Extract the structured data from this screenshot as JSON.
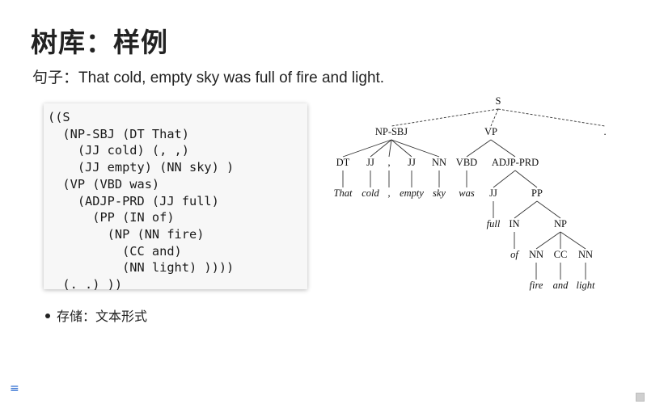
{
  "slide": {
    "title": "树库：样例",
    "sentence_label": "句子：",
    "sentence_text": "That cold, empty sky was full of fire and light.",
    "bullet": "存储：文本形式"
  },
  "code_lines": [
    "((S",
    "  (NP-SBJ (DT That)",
    "    (JJ cold) (, ,)",
    "    (JJ empty) (NN sky) )",
    "  (VP (VBD was)",
    "    (ADJP-PRD (JJ full)",
    "      (PP (IN of)",
    "        (NP (NN fire)",
    "          (CC and)",
    "          (NN light) ))))",
    "  (. .) ))"
  ],
  "tree": {
    "nodes": [
      {
        "id": "S",
        "label": "S",
        "kind": "cat"
      },
      {
        "id": "NPSBJ",
        "label": "NP-SBJ",
        "kind": "cat"
      },
      {
        "id": "VP",
        "label": "VP",
        "kind": "cat"
      },
      {
        "id": "DOT",
        "label": ".",
        "kind": "cat"
      },
      {
        "id": "DT",
        "label": "DT",
        "kind": "cat"
      },
      {
        "id": "JJ1",
        "label": "JJ",
        "kind": "cat"
      },
      {
        "id": "COMMA",
        "label": ",",
        "kind": "cat"
      },
      {
        "id": "JJ2",
        "label": "JJ",
        "kind": "cat"
      },
      {
        "id": "NN1",
        "label": "NN",
        "kind": "cat"
      },
      {
        "id": "VBD",
        "label": "VBD",
        "kind": "cat"
      },
      {
        "id": "ADJP",
        "label": "ADJP-PRD",
        "kind": "cat"
      },
      {
        "id": "JJ3",
        "label": "JJ",
        "kind": "cat"
      },
      {
        "id": "PP",
        "label": "PP",
        "kind": "cat"
      },
      {
        "id": "IN",
        "label": "IN",
        "kind": "cat"
      },
      {
        "id": "NP2",
        "label": "NP",
        "kind": "cat"
      },
      {
        "id": "NN2",
        "label": "NN",
        "kind": "cat"
      },
      {
        "id": "CC",
        "label": "CC",
        "kind": "cat"
      },
      {
        "id": "NN3",
        "label": "NN",
        "kind": "cat"
      },
      {
        "id": "w_that",
        "label": "That",
        "kind": "word"
      },
      {
        "id": "w_cold",
        "label": "cold",
        "kind": "word"
      },
      {
        "id": "w_comma",
        "label": ",",
        "kind": "word"
      },
      {
        "id": "w_empty",
        "label": "empty",
        "kind": "word"
      },
      {
        "id": "w_sky",
        "label": "sky",
        "kind": "word"
      },
      {
        "id": "w_was",
        "label": "was",
        "kind": "word"
      },
      {
        "id": "w_full",
        "label": "full",
        "kind": "word"
      },
      {
        "id": "w_of",
        "label": "of",
        "kind": "word"
      },
      {
        "id": "w_fire",
        "label": "fire",
        "kind": "word"
      },
      {
        "id": "w_and",
        "label": "and",
        "kind": "word"
      },
      {
        "id": "w_light",
        "label": "light",
        "kind": "word"
      }
    ],
    "edges": [
      {
        "from": "S",
        "to": "NPSBJ",
        "style": "dashed"
      },
      {
        "from": "S",
        "to": "VP",
        "style": "dashed"
      },
      {
        "from": "S",
        "to": "DOT",
        "style": "dashed"
      },
      {
        "from": "NPSBJ",
        "to": "DT",
        "style": "solid"
      },
      {
        "from": "NPSBJ",
        "to": "JJ1",
        "style": "solid"
      },
      {
        "from": "NPSBJ",
        "to": "COMMA",
        "style": "solid"
      },
      {
        "from": "NPSBJ",
        "to": "JJ2",
        "style": "solid"
      },
      {
        "from": "NPSBJ",
        "to": "NN1",
        "style": "solid"
      },
      {
        "from": "VP",
        "to": "VBD",
        "style": "solid"
      },
      {
        "from": "VP",
        "to": "ADJP",
        "style": "solid"
      },
      {
        "from": "ADJP",
        "to": "JJ3",
        "style": "solid"
      },
      {
        "from": "ADJP",
        "to": "PP",
        "style": "solid"
      },
      {
        "from": "PP",
        "to": "IN",
        "style": "solid"
      },
      {
        "from": "PP",
        "to": "NP2",
        "style": "solid"
      },
      {
        "from": "NP2",
        "to": "NN2",
        "style": "solid"
      },
      {
        "from": "NP2",
        "to": "CC",
        "style": "solid"
      },
      {
        "from": "NP2",
        "to": "NN3",
        "style": "solid"
      },
      {
        "from": "DT",
        "to": "w_that",
        "style": "solid"
      },
      {
        "from": "JJ1",
        "to": "w_cold",
        "style": "solid"
      },
      {
        "from": "COMMA",
        "to": "w_comma",
        "style": "solid"
      },
      {
        "from": "JJ2",
        "to": "w_empty",
        "style": "solid"
      },
      {
        "from": "NN1",
        "to": "w_sky",
        "style": "solid"
      },
      {
        "from": "VBD",
        "to": "w_was",
        "style": "solid"
      },
      {
        "from": "JJ3",
        "to": "w_full",
        "style": "solid"
      },
      {
        "from": "IN",
        "to": "w_of",
        "style": "solid"
      },
      {
        "from": "NN2",
        "to": "w_fire",
        "style": "solid"
      },
      {
        "from": "CC",
        "to": "w_and",
        "style": "solid"
      },
      {
        "from": "NN3",
        "to": "w_light",
        "style": "solid"
      }
    ]
  },
  "icons": {
    "menu": "menu-icon",
    "menu_glyph": "≡"
  }
}
